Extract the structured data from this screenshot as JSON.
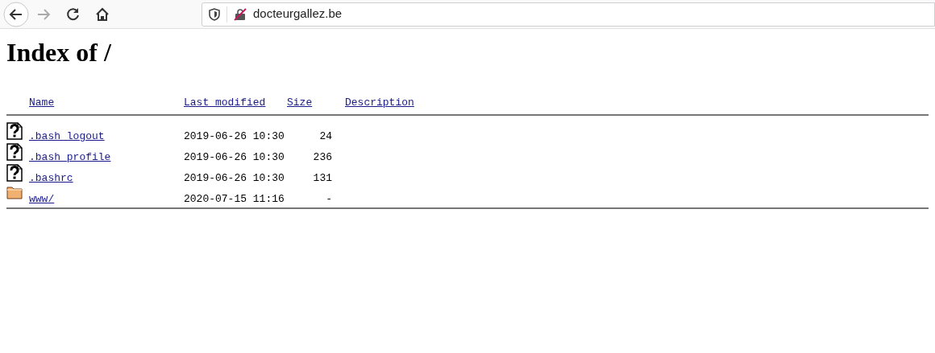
{
  "browser": {
    "url": "docteurgallez.be"
  },
  "title": "Index of /",
  "columns": [
    "Name",
    "Last modified",
    "Size",
    "Description"
  ],
  "rows": [
    {
      "kind": "file",
      "name": ".bash_logout",
      "modified": "2019-06-26 10:30",
      "size": "24"
    },
    {
      "kind": "file",
      "name": ".bash_profile",
      "modified": "2019-06-26 10:30",
      "size": "236"
    },
    {
      "kind": "file",
      "name": ".bashrc",
      "modified": "2019-06-26 10:30",
      "size": "131"
    },
    {
      "kind": "folder",
      "name": "www/",
      "modified": "2020-07-15 11:16",
      "size": "-"
    }
  ]
}
